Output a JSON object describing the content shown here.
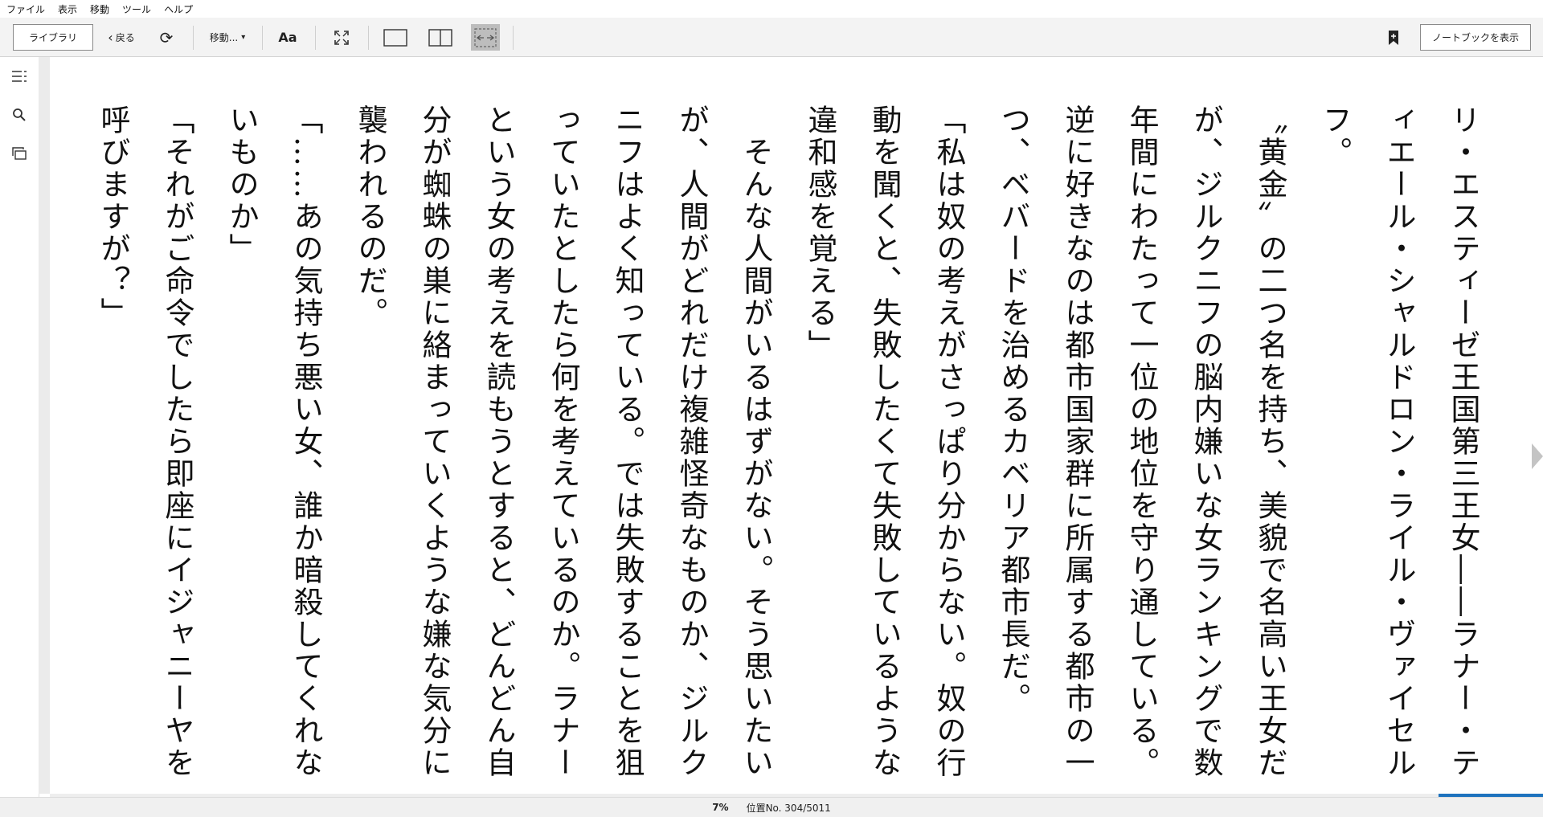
{
  "menu": [
    "ファイル",
    "表示",
    "移動",
    "ツール",
    "ヘルプ"
  ],
  "toolbar": {
    "library": "ライブラリ",
    "back": "戻る",
    "goto": "移動...",
    "font": "Aa",
    "notebook": "ノートブックを表示"
  },
  "content": {
    "lines": [
      "リ・エスティーゼ王国第三王女――ラナー・ティエール・シャルドロン・ライル・ヴァイセルフ。",
      "〝黄金〟の二つ名を持ち、美貌で名高い王女だが、ジルクニフの脳内嫌いな女ランキングで数年間にわたって一位の地位を守り通している。逆に好きなのは都市国家群に所属する都市の一つ、ベバードを治めるカベリア都市長だ。",
      "「私は奴の考えがさっぱり分からない。奴の行動を聞くと、失敗したくて失敗しているような違和感を覚える」",
      "　そんな人間がいるはずがない。そう思いたいが、人間がどれだけ複雑怪奇なものか、ジルクニフはよく知っている。では失敗することを狙っていたとしたら何を考えているのか。ラナーという女の考えを読もうとすると、どんどん自分が蜘蛛の巣に絡まっていくような嫌な気分に襲われるのだ。",
      "「……あの気持ち悪い女、誰か暗殺してくれないものか」",
      "「それがご命令でしたら即座にイジャニーヤを呼びますが？」"
    ]
  },
  "status": {
    "percent": "7%",
    "location": "位置No. 304/5011"
  },
  "progress_fraction": 0.07,
  "colors": {
    "accent": "#1e73be",
    "toolbar_bg": "#f3f3f3",
    "active_button": "#bdbdbd"
  }
}
